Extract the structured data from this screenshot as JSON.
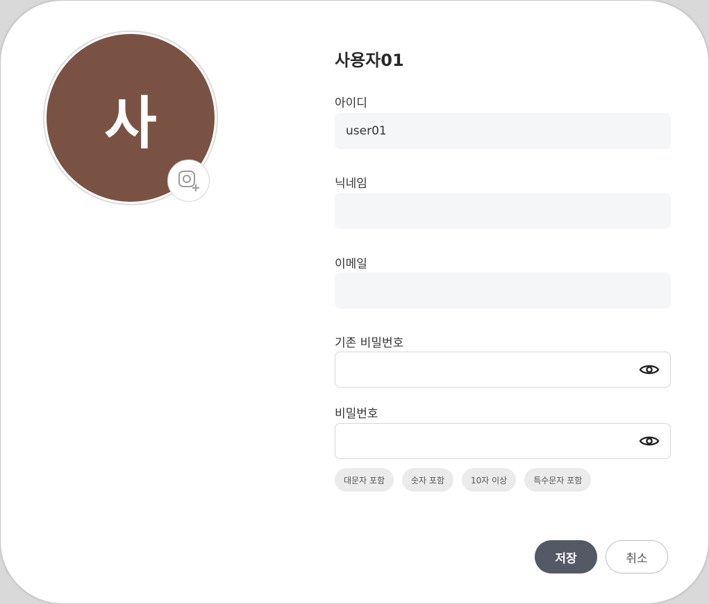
{
  "profile": {
    "display_name": "사용자01",
    "avatar_initial": "사",
    "avatar_color": "#7a5244",
    "camera_icon": "camera-add-icon"
  },
  "fields": {
    "id": {
      "label": "아이디",
      "value": "user01",
      "placeholder": ""
    },
    "nickname": {
      "label": "닉네임",
      "value": "",
      "placeholder": ""
    },
    "email": {
      "label": "이메일",
      "value": "",
      "placeholder": ""
    },
    "current_password": {
      "label": "기존 비밀번호",
      "value": "",
      "placeholder": "",
      "toggle_icon": "eye-icon"
    },
    "password": {
      "label": "비밀번호",
      "value": "",
      "placeholder": "",
      "toggle_icon": "eye-icon"
    }
  },
  "password_rules": [
    "대문자 포함",
    "숫자 포함",
    "10자 이상",
    "특수문자 포함"
  ],
  "actions": {
    "save_label": "저장",
    "cancel_label": "취소",
    "save_color": "#535a66"
  }
}
